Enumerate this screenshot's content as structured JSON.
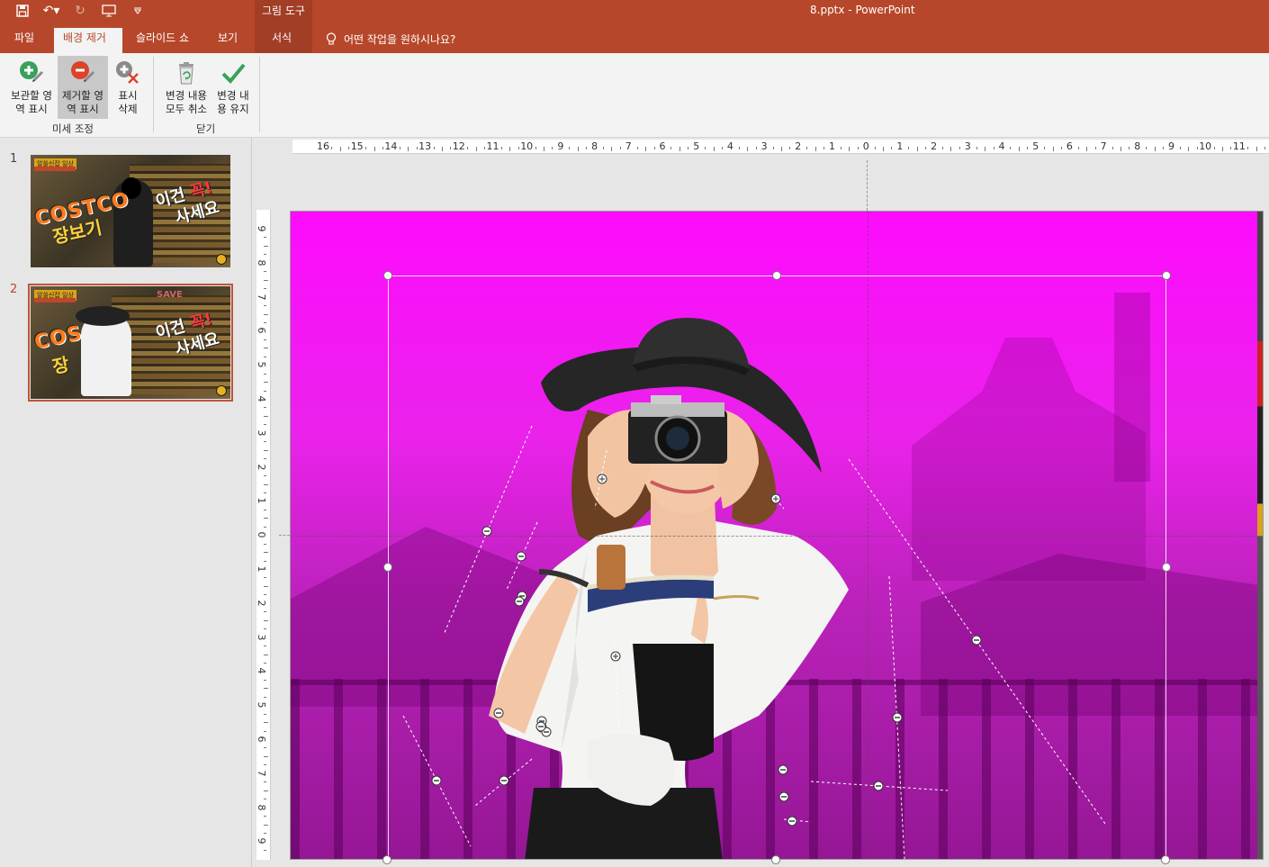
{
  "window": {
    "title": "8.pptx  -  PowerPoint",
    "context_group": "그림 도구"
  },
  "tabs": [
    {
      "label": "파일",
      "active": false
    },
    {
      "label": "배경 제거",
      "active": true
    },
    {
      "label": "슬라이드 쇼",
      "active": false
    },
    {
      "label": "보기",
      "active": false
    },
    {
      "label": "서식",
      "active": false
    }
  ],
  "tell_me": "어떤 작업을 원하시나요?",
  "ribbon": {
    "groups": [
      {
        "label": "미세 조정",
        "buttons": [
          {
            "label": "보관할 영\n역 표시",
            "icon": "plus-pencil-icon",
            "pressed": false
          },
          {
            "label": "제거할 영\n역 표시",
            "icon": "minus-pencil-icon",
            "pressed": true
          },
          {
            "label": "표시\n삭제",
            "icon": "delete-mark-icon",
            "pressed": false
          }
        ]
      },
      {
        "label": "닫기",
        "buttons": [
          {
            "label": "변경 내용\n모두 취소",
            "icon": "discard-icon",
            "pressed": false
          },
          {
            "label": "변경 내\n용 유지",
            "icon": "checkmark-icon",
            "pressed": false
          }
        ]
      }
    ]
  },
  "slides": [
    {
      "number": "1",
      "selected": false,
      "badge": "알쓸신잡 일상",
      "brand": "COSTCO",
      "subtitle": "장보기",
      "text1": "이건",
      "text_accent": "꼭!",
      "text2": "사세요"
    },
    {
      "number": "2",
      "selected": true,
      "badge": "알쓸신잡 일상",
      "brand": "COS",
      "subtitle": "장",
      "text1": "이건",
      "text_accent": "꼭!",
      "text2": "사세요",
      "sign": "SAVE"
    }
  ],
  "ruler": {
    "horizontal": [
      "16",
      "15",
      "14",
      "13",
      "12",
      "11",
      "10",
      "9",
      "8",
      "7",
      "6",
      "5",
      "4",
      "3",
      "2",
      "1",
      "0",
      "1",
      "2",
      "3",
      "4",
      "5",
      "6",
      "7",
      "8",
      "9",
      "10",
      "11"
    ],
    "vertical": [
      "9",
      "8",
      "7",
      "6",
      "5",
      "4",
      "3",
      "2",
      "1",
      "0",
      "1",
      "2",
      "3",
      "4",
      "5",
      "6",
      "7",
      "8",
      "9"
    ]
  },
  "colors": {
    "accent": "#b7472a",
    "removal_overlay": "#ff00ff"
  }
}
